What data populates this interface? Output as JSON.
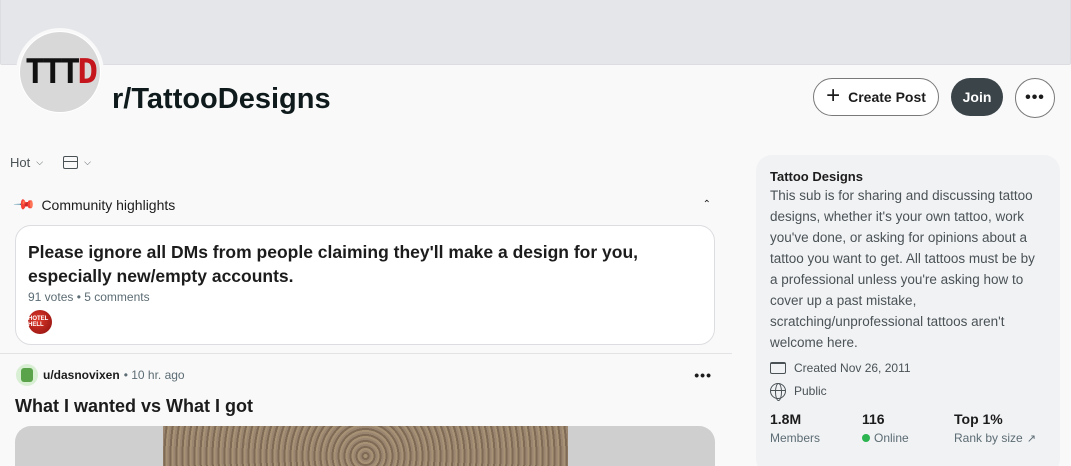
{
  "community": {
    "name": "r/TattooDesigns",
    "avatar_text_dark": "TTT",
    "avatar_text_red": "D"
  },
  "header": {
    "create_post_label": "Create Post",
    "join_label": "Join",
    "more_label": "•••"
  },
  "feed": {
    "sort_label": "Hot",
    "highlights_label": "Community highlights",
    "highlight": {
      "title": "Please ignore all DMs from people claiming they'll make a design for you, especially new/empty accounts.",
      "meta": "91 votes • 5 comments",
      "avatar_text": "HOTEL HELL"
    },
    "post": {
      "user": "u/dasnovixen",
      "time": "• 10 hr. ago",
      "title": "What I wanted vs What I got"
    }
  },
  "sidebar": {
    "title": "Tattoo Designs",
    "description": "This sub is for sharing and discussing tattoo designs, whether it's your own tattoo, work you've done, or asking for opinions about a tattoo you want to get. All tattoos must be by a professional unless you're asking how to cover up a past mistake, scratching/unprofessional tattoos aren't welcome here.",
    "created": "Created Nov 26, 2011",
    "visibility": "Public",
    "stats": [
      {
        "value": "1.8M",
        "label": "Members"
      },
      {
        "value": "116",
        "label": "Online"
      },
      {
        "value": "Top 1%",
        "label": "Rank by size"
      }
    ]
  },
  "colors": {
    "join_bg": "#3a4449",
    "online_dot": "#2bb44f",
    "logo_red": "#c4161c"
  }
}
